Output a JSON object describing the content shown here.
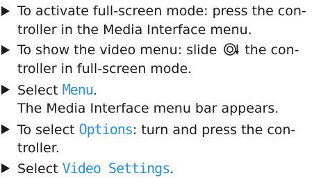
{
  "instructions": [
    {
      "lines": [
        {
          "parts": [
            {
              "text": "To activate full-screen mode: press the con-"
            }
          ]
        },
        {
          "parts": [
            {
              "text": "troller in the Media Interface menu."
            }
          ]
        }
      ]
    },
    {
      "lines": [
        {
          "parts": [
            {
              "text": "To show the video menu: slide "
            },
            {
              "text": " the con-"
            }
          ]
        },
        {
          "parts": [
            {
              "text": "troller in full-screen mode."
            }
          ]
        }
      ],
      "icon": "controller-slide-down-icon"
    },
    {
      "lines": [
        {
          "parts": [
            {
              "text": "Select "
            },
            {
              "text": "Menu",
              "highlight": true
            },
            {
              "text": "."
            }
          ]
        },
        {
          "parts": [
            {
              "text": "The Media Interface menu bar appears."
            }
          ]
        }
      ]
    },
    {
      "lines": [
        {
          "parts": [
            {
              "text": "To select "
            },
            {
              "text": "Options",
              "highlight": true
            },
            {
              "text": ": turn and press the con-"
            }
          ]
        },
        {
          "parts": [
            {
              "text": "troller."
            }
          ]
        }
      ]
    },
    {
      "lines": [
        {
          "parts": [
            {
              "text": "Select "
            },
            {
              "text": "Video Settings",
              "highlight": true
            },
            {
              "text": "."
            }
          ]
        }
      ]
    }
  ],
  "colors": {
    "highlight": "#2f8fc7",
    "text": "#1a1a1a"
  }
}
